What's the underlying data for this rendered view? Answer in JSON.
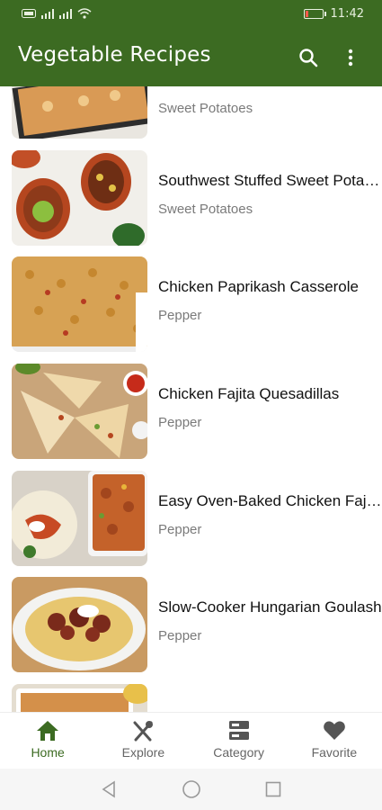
{
  "status_bar": {
    "left_indicators": [
      "NFC",
      "4G",
      "wifi"
    ],
    "time": "11:42",
    "battery_level": 0.15
  },
  "app_bar": {
    "title": "Vegetable Recipes",
    "actions": [
      "search-icon",
      "more-vert-icon"
    ]
  },
  "recipes": [
    {
      "title": "",
      "category": "Sweet Potatoes"
    },
    {
      "title": "Southwest Stuffed Sweet Potatoes",
      "category": "Sweet Potatoes"
    },
    {
      "title": "Chicken Paprikash Casserole",
      "category": "Pepper"
    },
    {
      "title": "Chicken Fajita Quesadillas",
      "category": "Pepper"
    },
    {
      "title": "Easy Oven-Baked Chicken Fajitas",
      "category": "Pepper"
    },
    {
      "title": "Slow-Cooker Hungarian Goulash",
      "category": "Pepper"
    }
  ],
  "bottom_nav": {
    "items": [
      {
        "label": "Home",
        "icon": "home-icon",
        "active": true
      },
      {
        "label": "Explore",
        "icon": "fork-knife-icon",
        "active": false
      },
      {
        "label": "Category",
        "icon": "category-icon",
        "active": false
      },
      {
        "label": "Favorite",
        "icon": "heart-icon",
        "active": false
      }
    ]
  },
  "colors": {
    "primary": "#3c6b22",
    "title_text": "#111111",
    "category_text": "#7a7a7a",
    "nav_inactive": "#666666"
  }
}
